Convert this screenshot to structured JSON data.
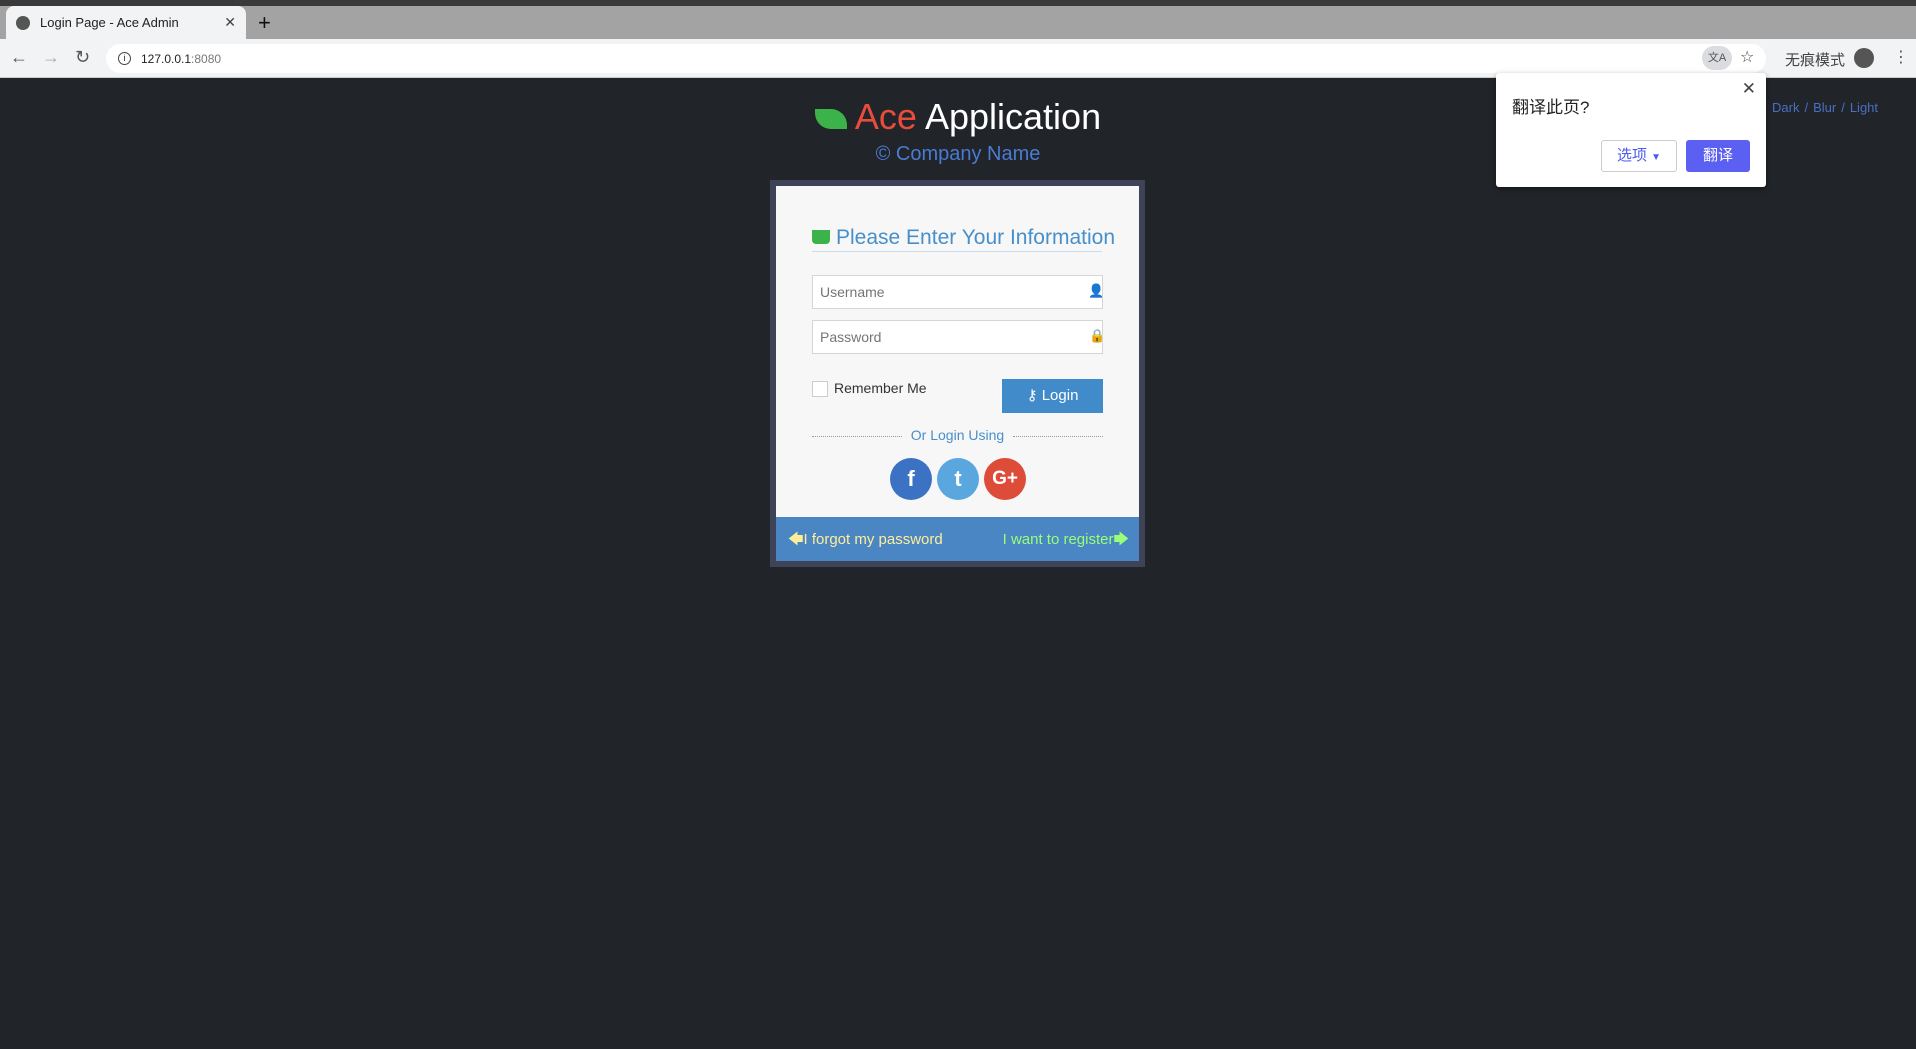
{
  "browser": {
    "tab_title": "Login Page - Ace Admin",
    "url_host": "127.0.0.1",
    "url_port": ":8080",
    "incognito_label": "无痕模式"
  },
  "translate": {
    "question": "翻译此页?",
    "options_label": "选项",
    "translate_label": "翻译"
  },
  "themes": [
    "Dark",
    "Blur",
    "Light"
  ],
  "brand": {
    "ace": "Ace",
    "app": "Application",
    "company": "© Company Name"
  },
  "login": {
    "heading": "Please Enter Your Information",
    "username_placeholder": "Username",
    "password_placeholder": "Password",
    "remember": "Remember Me",
    "login_button": "Login",
    "or_login": "Or Login Using",
    "social": [
      "f",
      "t",
      "G+"
    ],
    "forgot": "I forgot my password",
    "register": "I want to register"
  },
  "colors": {
    "ace": "#e74c3c",
    "accent": "#428bca",
    "facebook": "#3b72c4",
    "twitter": "#5aa7e0",
    "google": "#dd4b39",
    "background": "#212429"
  }
}
